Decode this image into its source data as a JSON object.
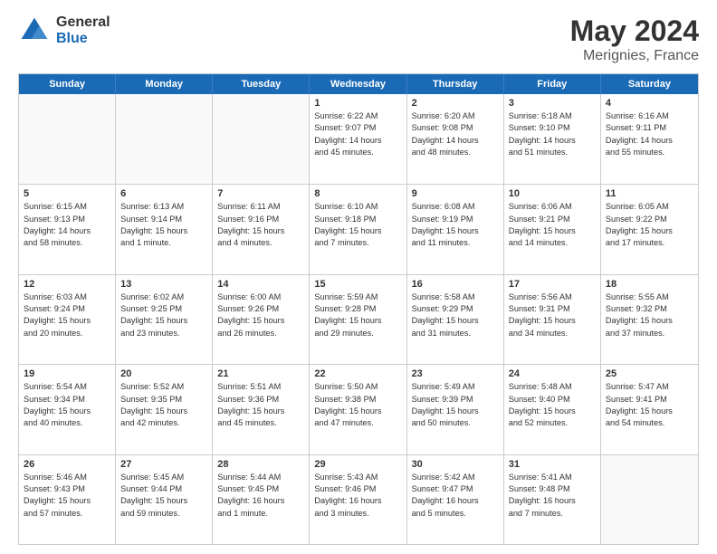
{
  "logo": {
    "general": "General",
    "blue": "Blue"
  },
  "title": {
    "month": "May 2024",
    "location": "Merignies, France"
  },
  "header_days": [
    "Sunday",
    "Monday",
    "Tuesday",
    "Wednesday",
    "Thursday",
    "Friday",
    "Saturday"
  ],
  "weeks": [
    [
      {
        "day": "",
        "info": [],
        "empty": true
      },
      {
        "day": "",
        "info": [],
        "empty": true
      },
      {
        "day": "",
        "info": [],
        "empty": true
      },
      {
        "day": "1",
        "info": [
          "Sunrise: 6:22 AM",
          "Sunset: 9:07 PM",
          "Daylight: 14 hours",
          "and 45 minutes."
        ]
      },
      {
        "day": "2",
        "info": [
          "Sunrise: 6:20 AM",
          "Sunset: 9:08 PM",
          "Daylight: 14 hours",
          "and 48 minutes."
        ]
      },
      {
        "day": "3",
        "info": [
          "Sunrise: 6:18 AM",
          "Sunset: 9:10 PM",
          "Daylight: 14 hours",
          "and 51 minutes."
        ]
      },
      {
        "day": "4",
        "info": [
          "Sunrise: 6:16 AM",
          "Sunset: 9:11 PM",
          "Daylight: 14 hours",
          "and 55 minutes."
        ]
      }
    ],
    [
      {
        "day": "5",
        "info": [
          "Sunrise: 6:15 AM",
          "Sunset: 9:13 PM",
          "Daylight: 14 hours",
          "and 58 minutes."
        ]
      },
      {
        "day": "6",
        "info": [
          "Sunrise: 6:13 AM",
          "Sunset: 9:14 PM",
          "Daylight: 15 hours",
          "and 1 minute."
        ]
      },
      {
        "day": "7",
        "info": [
          "Sunrise: 6:11 AM",
          "Sunset: 9:16 PM",
          "Daylight: 15 hours",
          "and 4 minutes."
        ]
      },
      {
        "day": "8",
        "info": [
          "Sunrise: 6:10 AM",
          "Sunset: 9:18 PM",
          "Daylight: 15 hours",
          "and 7 minutes."
        ]
      },
      {
        "day": "9",
        "info": [
          "Sunrise: 6:08 AM",
          "Sunset: 9:19 PM",
          "Daylight: 15 hours",
          "and 11 minutes."
        ]
      },
      {
        "day": "10",
        "info": [
          "Sunrise: 6:06 AM",
          "Sunset: 9:21 PM",
          "Daylight: 15 hours",
          "and 14 minutes."
        ]
      },
      {
        "day": "11",
        "info": [
          "Sunrise: 6:05 AM",
          "Sunset: 9:22 PM",
          "Daylight: 15 hours",
          "and 17 minutes."
        ]
      }
    ],
    [
      {
        "day": "12",
        "info": [
          "Sunrise: 6:03 AM",
          "Sunset: 9:24 PM",
          "Daylight: 15 hours",
          "and 20 minutes."
        ]
      },
      {
        "day": "13",
        "info": [
          "Sunrise: 6:02 AM",
          "Sunset: 9:25 PM",
          "Daylight: 15 hours",
          "and 23 minutes."
        ]
      },
      {
        "day": "14",
        "info": [
          "Sunrise: 6:00 AM",
          "Sunset: 9:26 PM",
          "Daylight: 15 hours",
          "and 26 minutes."
        ]
      },
      {
        "day": "15",
        "info": [
          "Sunrise: 5:59 AM",
          "Sunset: 9:28 PM",
          "Daylight: 15 hours",
          "and 29 minutes."
        ]
      },
      {
        "day": "16",
        "info": [
          "Sunrise: 5:58 AM",
          "Sunset: 9:29 PM",
          "Daylight: 15 hours",
          "and 31 minutes."
        ]
      },
      {
        "day": "17",
        "info": [
          "Sunrise: 5:56 AM",
          "Sunset: 9:31 PM",
          "Daylight: 15 hours",
          "and 34 minutes."
        ]
      },
      {
        "day": "18",
        "info": [
          "Sunrise: 5:55 AM",
          "Sunset: 9:32 PM",
          "Daylight: 15 hours",
          "and 37 minutes."
        ]
      }
    ],
    [
      {
        "day": "19",
        "info": [
          "Sunrise: 5:54 AM",
          "Sunset: 9:34 PM",
          "Daylight: 15 hours",
          "and 40 minutes."
        ]
      },
      {
        "day": "20",
        "info": [
          "Sunrise: 5:52 AM",
          "Sunset: 9:35 PM",
          "Daylight: 15 hours",
          "and 42 minutes."
        ]
      },
      {
        "day": "21",
        "info": [
          "Sunrise: 5:51 AM",
          "Sunset: 9:36 PM",
          "Daylight: 15 hours",
          "and 45 minutes."
        ]
      },
      {
        "day": "22",
        "info": [
          "Sunrise: 5:50 AM",
          "Sunset: 9:38 PM",
          "Daylight: 15 hours",
          "and 47 minutes."
        ]
      },
      {
        "day": "23",
        "info": [
          "Sunrise: 5:49 AM",
          "Sunset: 9:39 PM",
          "Daylight: 15 hours",
          "and 50 minutes."
        ]
      },
      {
        "day": "24",
        "info": [
          "Sunrise: 5:48 AM",
          "Sunset: 9:40 PM",
          "Daylight: 15 hours",
          "and 52 minutes."
        ]
      },
      {
        "day": "25",
        "info": [
          "Sunrise: 5:47 AM",
          "Sunset: 9:41 PM",
          "Daylight: 15 hours",
          "and 54 minutes."
        ]
      }
    ],
    [
      {
        "day": "26",
        "info": [
          "Sunrise: 5:46 AM",
          "Sunset: 9:43 PM",
          "Daylight: 15 hours",
          "and 57 minutes."
        ]
      },
      {
        "day": "27",
        "info": [
          "Sunrise: 5:45 AM",
          "Sunset: 9:44 PM",
          "Daylight: 15 hours",
          "and 59 minutes."
        ]
      },
      {
        "day": "28",
        "info": [
          "Sunrise: 5:44 AM",
          "Sunset: 9:45 PM",
          "Daylight: 16 hours",
          "and 1 minute."
        ]
      },
      {
        "day": "29",
        "info": [
          "Sunrise: 5:43 AM",
          "Sunset: 9:46 PM",
          "Daylight: 16 hours",
          "and 3 minutes."
        ]
      },
      {
        "day": "30",
        "info": [
          "Sunrise: 5:42 AM",
          "Sunset: 9:47 PM",
          "Daylight: 16 hours",
          "and 5 minutes."
        ]
      },
      {
        "day": "31",
        "info": [
          "Sunrise: 5:41 AM",
          "Sunset: 9:48 PM",
          "Daylight: 16 hours",
          "and 7 minutes."
        ]
      },
      {
        "day": "",
        "info": [],
        "empty": true
      }
    ]
  ]
}
